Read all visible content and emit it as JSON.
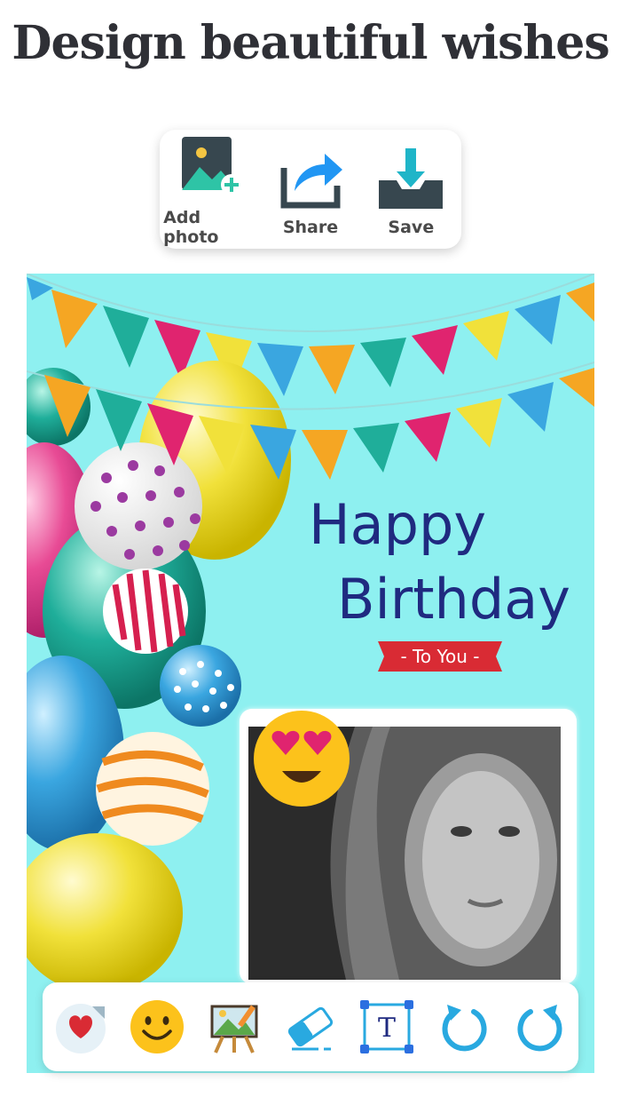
{
  "headline": "Design beautiful wishes",
  "top_toolbar": {
    "add_photo": {
      "label": "Add photo",
      "icon": "add-photo-icon"
    },
    "share": {
      "label": "Share",
      "icon": "share-icon"
    },
    "save": {
      "label": "Save",
      "icon": "download-icon"
    }
  },
  "card": {
    "line1": "Happy",
    "line2": "Birthday",
    "ribbon": "- To You -",
    "background_color": "#8ef0f0",
    "text_color": "#1f2a80",
    "ribbon_color": "#d92b34"
  },
  "bottom_toolbar": [
    {
      "icon": "sticker-icon"
    },
    {
      "icon": "smiley-icon"
    },
    {
      "icon": "easel-icon"
    },
    {
      "icon": "eraser-icon"
    },
    {
      "icon": "text-box-icon",
      "glyph": "T"
    },
    {
      "icon": "undo-icon"
    },
    {
      "icon": "redo-icon"
    }
  ]
}
